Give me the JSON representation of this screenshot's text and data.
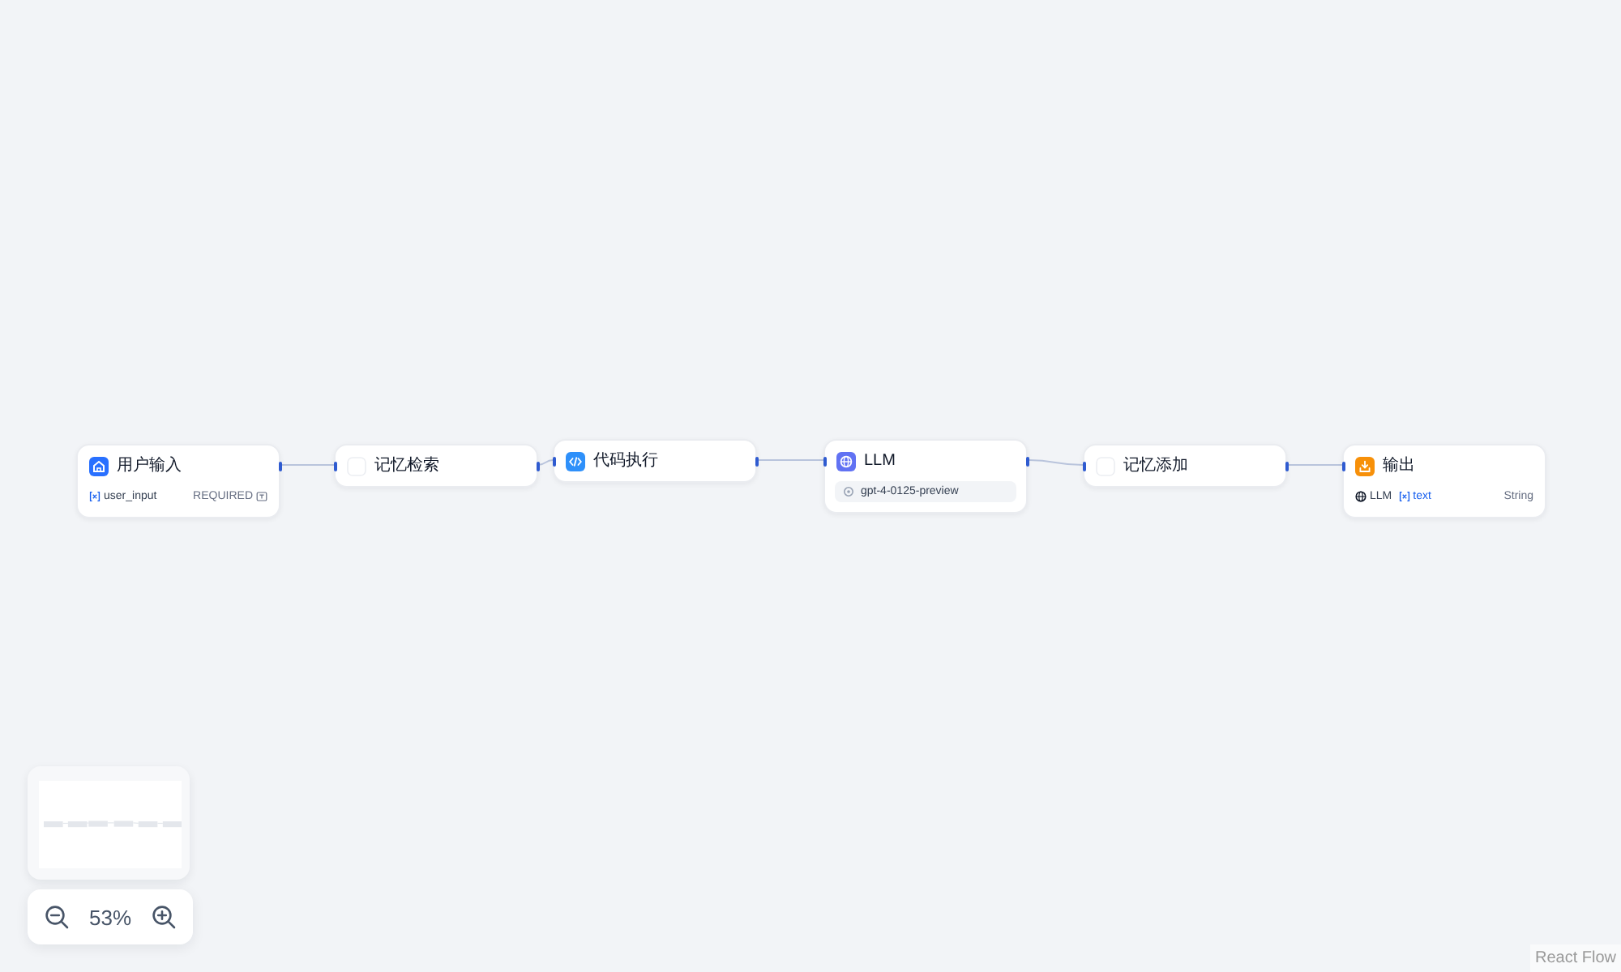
{
  "canvas": {
    "nodes": [
      {
        "kind": "start",
        "title": "用户输入",
        "color": "#2970ff",
        "variables": [
          {
            "name": "user_input",
            "tag": "REQUIRED"
          }
        ]
      },
      {
        "kind": "memory",
        "title": "记忆检索"
      },
      {
        "kind": "code",
        "title": "代码执行",
        "color": "#2e90fa"
      },
      {
        "kind": "llm",
        "title": "LLM",
        "color": "#6172f3",
        "model": "gpt-4-0125-preview"
      },
      {
        "kind": "memory",
        "title": "记忆添加"
      },
      {
        "kind": "end",
        "title": "输出",
        "color": "#f79009",
        "outputs": [
          {
            "source": "LLM",
            "variable": "text",
            "type": "String"
          }
        ]
      }
    ]
  },
  "zoom_controls": {
    "zoom_text": "53%"
  },
  "attribution": {
    "text": "React Flow"
  }
}
